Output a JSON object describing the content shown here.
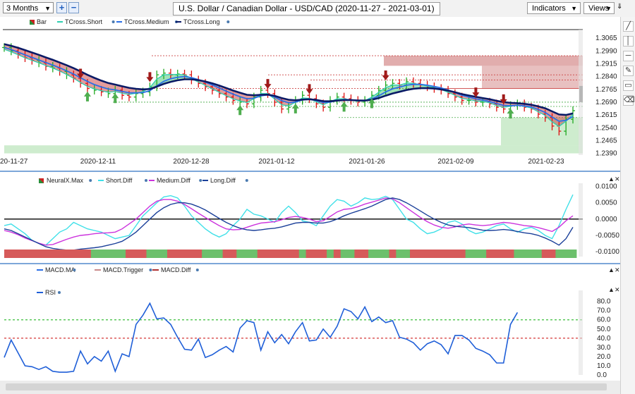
{
  "toolbar": {
    "period": "3 Months",
    "title": "U.S. Dollar / Canadian Dollar - USD/CAD (2020-11-27 - 2021-03-01)",
    "indicators_label": "Indicators",
    "views_label": "Views",
    "zoom_in_icon": "plus-icon",
    "zoom_out_icon": "minus-icon"
  },
  "colors": {
    "up_bar": "#22aa22",
    "down_bar": "#dd1111",
    "tcross_short": "#2ecfb0",
    "tcross_medium": "#2a6fe6",
    "tcross_long": "#0a1a66",
    "short_diff": "#3fe0e8",
    "medium_diff": "#cc33dd",
    "long_diff": "#1a3f99",
    "rsi": "#1f5fd8"
  },
  "chart_data": [
    {
      "type": "bar",
      "name": "price",
      "legend": [
        "Bar",
        "TCross.Short",
        "TCross.Medium",
        "TCross.Long"
      ],
      "x_ticks": [
        "20-11-27",
        "2020-12-11",
        "2020-12-28",
        "2021-01-12",
        "2021-01-26",
        "2021-02-09",
        "2021-02-23"
      ],
      "y_ticks": [
        "1.3065",
        "1.2990",
        "1.2915",
        "1.2840",
        "1.2765",
        "1.2690",
        "1.2615",
        "1.2540",
        "1.2465",
        "1.2390"
      ],
      "ylim": [
        1.238,
        1.3115
      ],
      "close": [
        1.301,
        1.299,
        1.297,
        1.295,
        1.2935,
        1.292,
        1.29,
        1.289,
        1.287,
        1.285,
        1.283,
        1.28,
        1.277,
        1.276,
        1.275,
        1.274,
        1.276,
        1.273,
        1.272,
        1.274,
        1.275,
        1.278,
        1.285,
        1.286,
        1.285,
        1.2855,
        1.285,
        1.282,
        1.28,
        1.278,
        1.276,
        1.274,
        1.272,
        1.27,
        1.269,
        1.268,
        1.272,
        1.276,
        1.274,
        1.269,
        1.265,
        1.266,
        1.27,
        1.273,
        1.271,
        1.268,
        1.266,
        1.27,
        1.272,
        1.271,
        1.27,
        1.269,
        1.27,
        1.273,
        1.276,
        1.279,
        1.28,
        1.279,
        1.281,
        1.28,
        1.279,
        1.278,
        1.277,
        1.276,
        1.274,
        1.272,
        1.27,
        1.27,
        1.269,
        1.269,
        1.268,
        1.266,
        1.265,
        1.267,
        1.268,
        1.266,
        1.265,
        1.262,
        1.26,
        1.255,
        1.252,
        1.259,
        1.264
      ],
      "tcross_short": [
        1.3,
        1.2985,
        1.2968,
        1.295,
        1.2935,
        1.292,
        1.2905,
        1.289,
        1.2872,
        1.2852,
        1.283,
        1.2805,
        1.2782,
        1.2768,
        1.2757,
        1.2748,
        1.2752,
        1.2742,
        1.2735,
        1.2742,
        1.2752,
        1.2775,
        1.2825,
        1.285,
        1.2852,
        1.2853,
        1.285,
        1.2828,
        1.2808,
        1.2788,
        1.2768,
        1.2748,
        1.2728,
        1.271,
        1.2697,
        1.2688,
        1.271,
        1.274,
        1.274,
        1.2708,
        1.2675,
        1.2668,
        1.269,
        1.2715,
        1.2712,
        1.2692,
        1.2675,
        1.2692,
        1.271,
        1.271,
        1.2703,
        1.2695,
        1.2698,
        1.272,
        1.2748,
        1.2775,
        1.279,
        1.279,
        1.2802,
        1.28,
        1.2793,
        1.2784,
        1.2775,
        1.2764,
        1.2748,
        1.273,
        1.2712,
        1.2706,
        1.2697,
        1.2694,
        1.2686,
        1.267,
        1.266,
        1.2666,
        1.2673,
        1.2665,
        1.2656,
        1.2634,
        1.2612,
        1.2575,
        1.2548,
        1.2578,
        1.262
      ],
      "tcross_medium": [
        1.301,
        1.2998,
        1.2983,
        1.2967,
        1.2952,
        1.2937,
        1.2922,
        1.2907,
        1.2891,
        1.2873,
        1.2855,
        1.2833,
        1.2811,
        1.2793,
        1.2779,
        1.2767,
        1.2762,
        1.2753,
        1.2745,
        1.2744,
        1.2746,
        1.2757,
        1.2786,
        1.2812,
        1.2827,
        1.2836,
        1.284,
        1.2834,
        1.2822,
        1.2807,
        1.2791,
        1.2773,
        1.2755,
        1.2737,
        1.2722,
        1.271,
        1.2713,
        1.2727,
        1.2733,
        1.272,
        1.2699,
        1.2687,
        1.269,
        1.2703,
        1.2707,
        1.2699,
        1.2688,
        1.269,
        1.27,
        1.2705,
        1.2704,
        1.27,
        1.2699,
        1.2709,
        1.2727,
        1.275,
        1.2768,
        1.2778,
        1.2789,
        1.2794,
        1.2794,
        1.2789,
        1.2782,
        1.2773,
        1.2761,
        1.2746,
        1.273,
        1.272,
        1.2709,
        1.2702,
        1.2694,
        1.2682,
        1.2671,
        1.2669,
        1.2671,
        1.2668,
        1.2662,
        1.2647,
        1.263,
        1.2603,
        1.2578,
        1.2583,
        1.2606
      ],
      "tcross_long": [
        1.303,
        1.302,
        1.3008,
        1.2995,
        1.2981,
        1.2967,
        1.2952,
        1.2938,
        1.2922,
        1.2906,
        1.2889,
        1.287,
        1.285,
        1.2832,
        1.2816,
        1.2802,
        1.2793,
        1.2783,
        1.2774,
        1.2768,
        1.2765,
        1.2767,
        1.2781,
        1.2797,
        1.2809,
        1.2818,
        1.2824,
        1.2824,
        1.2819,
        1.2811,
        1.28,
        1.2787,
        1.2773,
        1.2758,
        1.2745,
        1.2733,
        1.273,
        1.2733,
        1.2734,
        1.2727,
        1.2714,
        1.2704,
        1.2701,
        1.2705,
        1.2707,
        1.2703,
        1.2696,
        1.2695,
        1.2699,
        1.2702,
        1.2702,
        1.27,
        1.2699,
        1.2704,
        1.2714,
        1.2728,
        1.2741,
        1.2751,
        1.2761,
        1.2768,
        1.2772,
        1.2772,
        1.277,
        1.2765,
        1.2758,
        1.2748,
        1.2737,
        1.2729,
        1.2721,
        1.2714,
        1.2707,
        1.2698,
        1.269,
        1.2686,
        1.2684,
        1.268,
        1.2675,
        1.2665,
        1.2654,
        1.2636,
        1.2618,
        1.2615,
        1.2624
      ],
      "bar_signal": [
        1,
        1,
        -1,
        -1,
        -1,
        1,
        -1,
        1,
        -1,
        1,
        -1,
        -1,
        -1,
        1,
        -1,
        1,
        1,
        -1,
        -1,
        1,
        1,
        1,
        1,
        1,
        -1,
        1,
        -1,
        -1,
        -1,
        -1,
        -1,
        -1,
        -1,
        -1,
        1,
        -1,
        1,
        1,
        -1,
        -1,
        -1,
        1,
        1,
        1,
        -1,
        -1,
        -1,
        1,
        1,
        -1,
        -1,
        -1,
        1,
        1,
        1,
        1,
        1,
        -1,
        1,
        -1,
        -1,
        -1,
        -1,
        -1,
        -1,
        -1,
        -1,
        1,
        -1,
        1,
        -1,
        -1,
        -1,
        1,
        1,
        -1,
        -1,
        -1,
        -1,
        -1,
        -1,
        1,
        1
      ],
      "buy_arrows_x_index": [
        11,
        15,
        33,
        42,
        48,
        54,
        72
      ],
      "sell_arrows_x_index": [
        21,
        11,
        38,
        44,
        55,
        68,
        72
      ]
    },
    {
      "type": "line",
      "name": "neuralx",
      "legend": [
        "NeuralX.Max",
        "Short.Diff",
        "Medium.Diff",
        "Long.Diff"
      ],
      "y_ticks": [
        "0.0100",
        "0.0050",
        "0.0000",
        "-0.0050",
        "-0.0100"
      ],
      "ylim": [
        -0.0115,
        0.011
      ],
      "series": [
        {
          "name": "Short.Diff",
          "values": [
            -0.002,
            -0.0015,
            -0.003,
            -0.0045,
            -0.0065,
            -0.0075,
            -0.008,
            -0.006,
            -0.004,
            -0.003,
            -0.001,
            -0.002,
            -0.003,
            -0.0035,
            -0.004,
            -0.005,
            -0.006,
            -0.0055,
            -0.005,
            -0.002,
            0.001,
            0.003,
            0.005,
            0.0068,
            0.0072,
            0.0065,
            0.004,
            0.001,
            -0.001,
            -0.003,
            -0.0045,
            -0.0055,
            -0.0045,
            -0.002,
            0.0,
            0.003,
            0.0015,
            0.001,
            0.0,
            -0.001,
            0.002,
            0.004,
            0.002,
            -0.0005,
            -0.001,
            -0.002,
            0.001,
            0.004,
            0.006,
            0.0055,
            0.004,
            0.005,
            0.0065,
            0.006,
            0.0062,
            0.007,
            0.006,
            0.003,
            0.0,
            -0.001,
            -0.003,
            -0.0045,
            -0.004,
            -0.003,
            -0.001,
            -0.0005,
            -0.0015,
            -0.0035,
            -0.0045,
            -0.004,
            -0.003,
            -0.002,
            -0.0015,
            -0.003,
            -0.004,
            -0.003,
            -0.0025,
            -0.0035,
            -0.005,
            -0.006,
            -0.002,
            0.003,
            0.0075
          ]
        },
        {
          "name": "Medium.Diff",
          "values": [
            -0.0035,
            -0.004,
            -0.0048,
            -0.0058,
            -0.0066,
            -0.0074,
            -0.008,
            -0.0078,
            -0.007,
            -0.0062,
            -0.0055,
            -0.005,
            -0.0048,
            -0.0045,
            -0.0043,
            -0.0042,
            -0.004,
            -0.003,
            -0.0015,
            0.0,
            0.002,
            0.004,
            0.0055,
            0.006,
            0.006,
            0.0055,
            0.0045,
            0.0032,
            0.0018,
            0.0005,
            -0.0008,
            -0.002,
            -0.003,
            -0.0033,
            -0.0032,
            -0.0025,
            -0.0018,
            -0.0012,
            -0.001,
            -0.0008,
            -0.0002,
            0.0005,
            0.0008,
            0.0005,
            0.0,
            -0.0008,
            -0.0005,
            0.0008,
            0.0022,
            0.003,
            0.0032,
            0.0038,
            0.0046,
            0.0052,
            0.0058,
            0.0065,
            0.0062,
            0.005,
            0.0035,
            0.002,
            0.0005,
            -0.0008,
            -0.0018,
            -0.0025,
            -0.0028,
            -0.0024,
            -0.0018,
            -0.0015,
            -0.0018,
            -0.002,
            -0.0018,
            -0.0014,
            -0.001,
            -0.0012,
            -0.0016,
            -0.002,
            -0.0022,
            -0.0026,
            -0.0032,
            -0.0038,
            -0.0025,
            -0.0005,
            0.001
          ]
        },
        {
          "name": "Long.Diff",
          "values": [
            -0.003,
            -0.0035,
            -0.0045,
            -0.0055,
            -0.0065,
            -0.0075,
            -0.0085,
            -0.009,
            -0.0093,
            -0.0095,
            -0.0095,
            -0.0092,
            -0.009,
            -0.0088,
            -0.0085,
            -0.008,
            -0.0075,
            -0.0068,
            -0.0055,
            -0.004,
            -0.002,
            0.0,
            0.002,
            0.0035,
            0.0045,
            0.005,
            0.005,
            0.0046,
            0.0038,
            0.0028,
            0.0015,
            0.0002,
            -0.001,
            -0.002,
            -0.0028,
            -0.0033,
            -0.0035,
            -0.0033,
            -0.003,
            -0.0028,
            -0.0024,
            -0.0018,
            -0.0012,
            -0.001,
            -0.001,
            -0.0012,
            -0.0012,
            -0.0008,
            0.0,
            0.001,
            0.0018,
            0.0025,
            0.0032,
            0.004,
            0.005,
            0.006,
            0.0065,
            0.006,
            0.005,
            0.0038,
            0.0025,
            0.0012,
            0.0,
            -0.001,
            -0.0018,
            -0.0022,
            -0.0024,
            -0.0026,
            -0.003,
            -0.0034,
            -0.0035,
            -0.0034,
            -0.0032,
            -0.0034,
            -0.0038,
            -0.0042,
            -0.0045,
            -0.005,
            -0.0058,
            -0.0068,
            -0.008,
            -0.006,
            -0.0025
          ]
        }
      ],
      "neuralx_signal": [
        -1,
        -1,
        -1,
        -1,
        -1,
        -1,
        -1,
        -1,
        -1,
        -1,
        -1,
        -1,
        -1,
        1,
        1,
        1,
        1,
        1,
        -1,
        -1,
        -1,
        1,
        1,
        1,
        -1,
        -1,
        -1,
        -1,
        -1,
        1,
        1,
        1,
        -1,
        -1,
        1,
        1,
        1,
        -1,
        -1,
        -1,
        -1,
        -1,
        -1,
        1,
        -1,
        -1,
        -1,
        1,
        -1,
        1,
        1,
        -1,
        -1,
        1,
        1,
        1,
        -1,
        1,
        1,
        -1,
        -1,
        -1,
        -1,
        -1,
        -1,
        -1,
        -1,
        1,
        1,
        1,
        -1,
        -1,
        -1,
        -1,
        1,
        1,
        1,
        1,
        -1,
        -1,
        1,
        1,
        1
      ]
    },
    {
      "type": "line",
      "name": "oscillator",
      "legend": [
        "MACD.MA",
        "MACD.Trigger",
        "MACD.Diff",
        "RSI"
      ],
      "y_ticks": [
        "80.0",
        "70.0",
        "60.0",
        "50.0",
        "40.0",
        "30.0",
        "20.0",
        "10.0",
        "0.0"
      ],
      "ylim": [
        0,
        92
      ],
      "overbought": 60,
      "oversold": 40,
      "series": [
        {
          "name": "RSI",
          "values": [
            19,
            38,
            24,
            10,
            9,
            6,
            9,
            4,
            3,
            3,
            4,
            26,
            12,
            20,
            15,
            26,
            4,
            23,
            20,
            55,
            65,
            78,
            61,
            62,
            55,
            41,
            28,
            27,
            39,
            19,
            22,
            27,
            31,
            25,
            51,
            59,
            57,
            27,
            47,
            35,
            44,
            34,
            47,
            57,
            37,
            38,
            50,
            41,
            53,
            72,
            69,
            61,
            74,
            58,
            63,
            57,
            59,
            41,
            39,
            35,
            27,
            34,
            37,
            33,
            23,
            43,
            43,
            38,
            29,
            26,
            22,
            13,
            13,
            55,
            68
          ]
        }
      ]
    }
  ],
  "tools": [
    {
      "name": "line-tool-icon",
      "glyph": "╱"
    },
    {
      "name": "vertical-line-icon",
      "glyph": "│"
    },
    {
      "name": "horizontal-line-icon",
      "glyph": "─"
    },
    {
      "name": "brush-tool-icon",
      "glyph": "✎"
    },
    {
      "name": "rectangle-tool-icon",
      "glyph": "▭"
    },
    {
      "name": "eraser-tool-icon",
      "glyph": "⌫"
    }
  ]
}
